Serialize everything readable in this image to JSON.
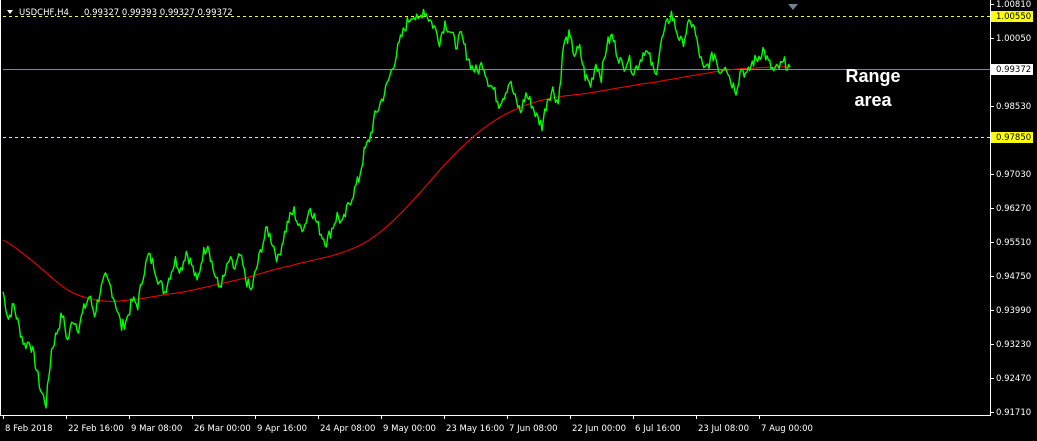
{
  "header": {
    "symbol": "USDCHF,H4",
    "ohlc": "0.99327 0.99393 0.99327 0.99372",
    "menu_icon": "triangle-down-icon"
  },
  "annotation": {
    "line1": "Range",
    "line2": "area"
  },
  "colors": {
    "background": "#000000",
    "price": "#00ff00",
    "ma": "#ff0000",
    "level": "#ffff00",
    "current_line": "#778899",
    "axis": "#ffffff"
  },
  "chart_data": {
    "type": "line",
    "ylim": [
      0.9165,
      1.009
    ],
    "y_ticks": [
      "1.00810",
      "1.00050",
      "0.99372",
      "0.98530",
      "0.97850",
      "0.97030",
      "0.96270",
      "0.95510",
      "0.94750",
      "0.93990",
      "0.93230",
      "0.92470",
      "0.91710"
    ],
    "y_tick_values": [
      1.0081,
      1.0005,
      0.99372,
      0.9853,
      0.9785,
      0.9703,
      0.9627,
      0.9551,
      0.9475,
      0.9399,
      0.9323,
      0.9247,
      0.9171
    ],
    "x_ticks": [
      "8 Feb 2018",
      "22 Feb 16:00",
      "9 Mar 08:00",
      "26 Mar 00:00",
      "9 Apr 16:00",
      "24 Apr 08:00",
      "9 May 00:00",
      "23 May 16:00",
      "7 Jun 08:00",
      "22 Jun 00:00",
      "6 Jul 16:00",
      "23 Jul 08:00",
      "7 Aug 00:00"
    ],
    "x_tick_index": [
      0,
      20,
      40,
      60,
      80,
      100,
      120,
      140,
      160,
      180,
      200,
      220,
      240
    ],
    "levels": [
      {
        "value": 1.0055,
        "label": "1.00550",
        "style": "dashed"
      },
      {
        "value": 0.9785,
        "label": "0.97850",
        "style": "dashed"
      }
    ],
    "current_price": {
      "value": 0.99372,
      "label": "0.99372"
    },
    "series": [
      {
        "kind": "price",
        "values": [
          0.944,
          0.938,
          0.941,
          0.936,
          0.932,
          0.933,
          0.928,
          0.922,
          0.919,
          0.931,
          0.935,
          0.939,
          0.933,
          0.938,
          0.936,
          0.94,
          0.943,
          0.939,
          0.944,
          0.947,
          0.945,
          0.941,
          0.936,
          0.938,
          0.942,
          0.941,
          0.948,
          0.952,
          0.95,
          0.946,
          0.944,
          0.948,
          0.951,
          0.949,
          0.953,
          0.95,
          0.946,
          0.952,
          0.955,
          0.949,
          0.945,
          0.947,
          0.951,
          0.949,
          0.952,
          0.947,
          0.944,
          0.949,
          0.954,
          0.958,
          0.955,
          0.951,
          0.956,
          0.96,
          0.962,
          0.958,
          0.959,
          0.963,
          0.96,
          0.957,
          0.955,
          0.958,
          0.961,
          0.959,
          0.963,
          0.966,
          0.969,
          0.975,
          0.978,
          0.983,
          0.986,
          0.989,
          0.993,
          0.997,
          1.001,
          1.004,
          1.006,
          1.004,
          1.007,
          1.005,
          1.003,
          1.0,
          1.004,
          1.002,
          0.999,
          1.001,
          0.997,
          0.994,
          0.993,
          0.995,
          0.991,
          0.989,
          0.986,
          0.988,
          0.991,
          0.987,
          0.984,
          0.988,
          0.986,
          0.983,
          0.981,
          0.987,
          0.989,
          0.986,
          0.999,
          1.001,
          0.997,
          0.998,
          0.992,
          0.99,
          0.995,
          0.992,
          0.999,
          1.001,
          0.997,
          0.994,
          0.996,
          0.993,
          0.995,
          0.998,
          0.996,
          0.992,
          0.999,
          1.003,
          1.006,
          1.002,
          0.999,
          1.003,
          1.004,
          0.998,
          0.993,
          0.995,
          0.997,
          0.993,
          0.995,
          0.991,
          0.989,
          0.994,
          0.992,
          0.995,
          0.996,
          0.998,
          0.995,
          0.993,
          0.994,
          0.995,
          0.994
        ],
        "note": "sampled closes, evenly spaced in time from 8 Feb 2018 to 10 Aug 2018"
      },
      {
        "kind": "moving_average",
        "values": [
          0.9555,
          0.9545,
          0.9532,
          0.9519,
          0.9505,
          0.949,
          0.9475,
          0.946,
          0.9447,
          0.9437,
          0.943,
          0.9425,
          0.9421,
          0.9419,
          0.9418,
          0.9419,
          0.9421,
          0.9423,
          0.9425,
          0.9428,
          0.9431,
          0.9434,
          0.9436,
          0.9439,
          0.9442,
          0.9446,
          0.945,
          0.9454,
          0.9458,
          0.9462,
          0.9466,
          0.947,
          0.9475,
          0.948,
          0.9485,
          0.949,
          0.9494,
          0.9498,
          0.9503,
          0.9507,
          0.9511,
          0.9515,
          0.9519,
          0.9524,
          0.953,
          0.9537,
          0.9545,
          0.9555,
          0.9567,
          0.9581,
          0.9597,
          0.9614,
          0.9632,
          0.9651,
          0.967,
          0.969,
          0.971,
          0.9729,
          0.9747,
          0.9764,
          0.978,
          0.9795,
          0.9808,
          0.982,
          0.9831,
          0.984,
          0.9848,
          0.9855,
          0.9861,
          0.9866,
          0.987,
          0.9873,
          0.9876,
          0.9878,
          0.988,
          0.9882,
          0.9885,
          0.9888,
          0.9891,
          0.9894,
          0.9897,
          0.99,
          0.9903,
          0.9905,
          0.9908,
          0.9911,
          0.9914,
          0.9917,
          0.992,
          0.9923,
          0.9926,
          0.9929,
          0.9932,
          0.9934,
          0.9936,
          0.9937,
          0.9938,
          0.9939,
          0.994,
          0.994,
          0.9941,
          0.9941
        ]
      }
    ]
  }
}
